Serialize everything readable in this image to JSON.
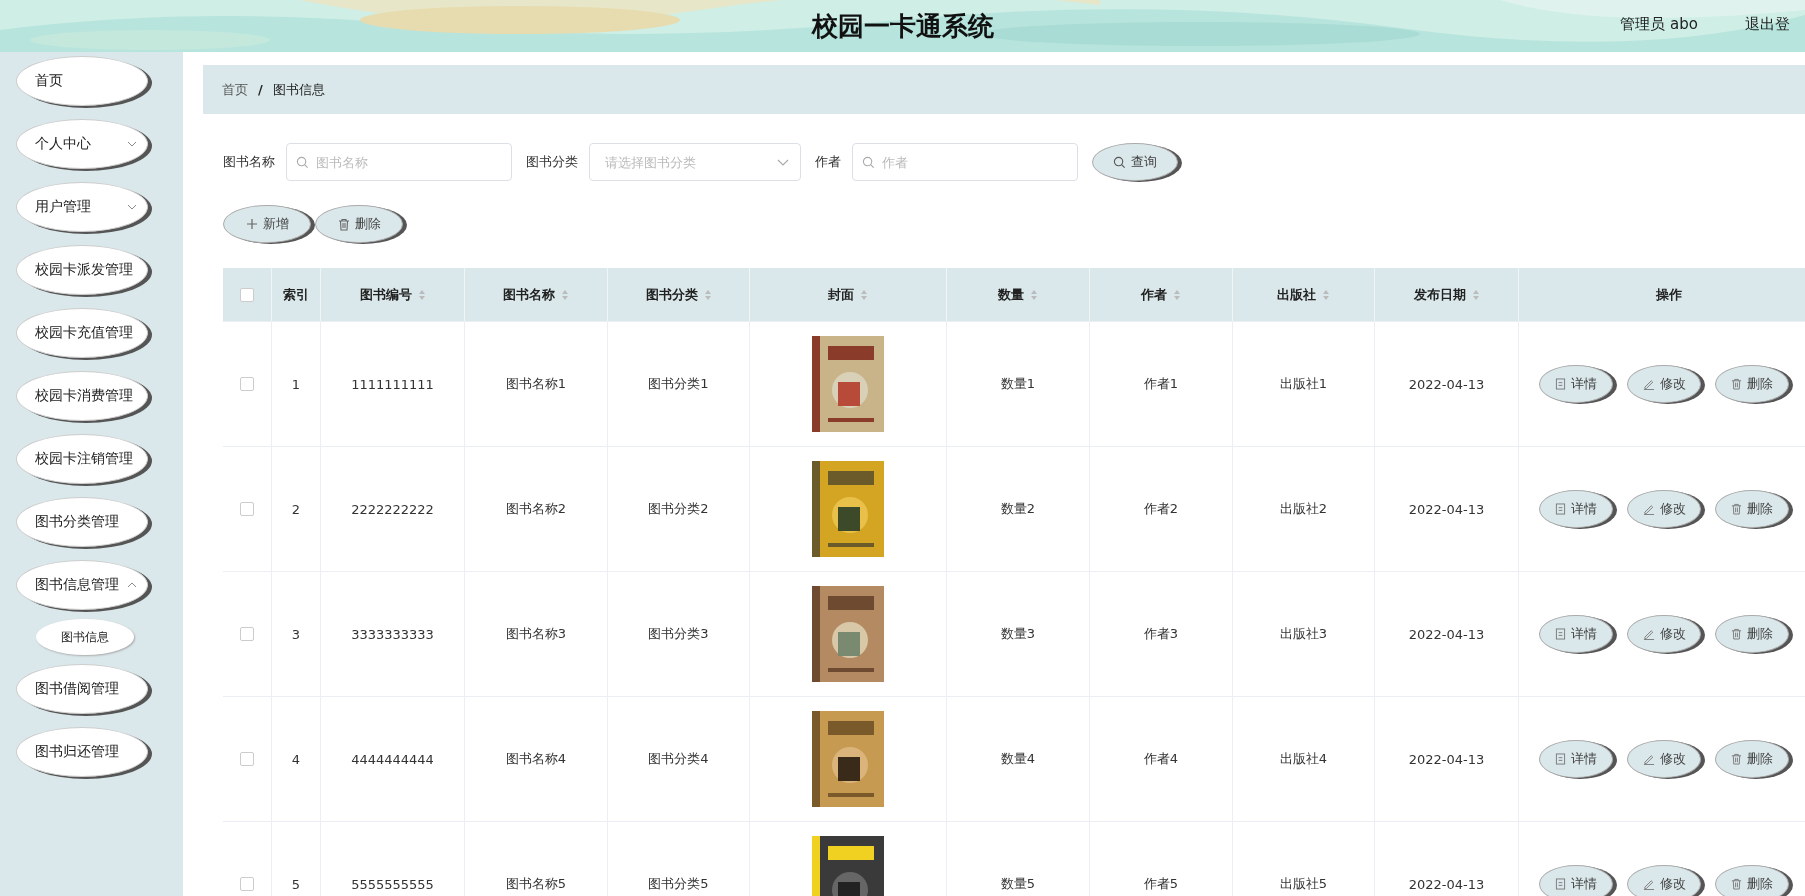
{
  "header": {
    "title": "校园一卡通系统",
    "user": "管理员 abo",
    "logout": "退出登"
  },
  "sidebar": {
    "items": [
      {
        "label": "首页"
      },
      {
        "label": "个人中心",
        "expanded": false
      },
      {
        "label": "用户管理",
        "expanded": false
      },
      {
        "label": "校园卡派发管理"
      },
      {
        "label": "校园卡充值管理"
      },
      {
        "label": "校园卡消费管理"
      },
      {
        "label": "校园卡注销管理"
      },
      {
        "label": "图书分类管理"
      },
      {
        "label": "图书信息管理",
        "expanded": true,
        "children": [
          {
            "label": "图书信息"
          }
        ]
      },
      {
        "label": "图书借阅管理"
      },
      {
        "label": "图书归还管理"
      }
    ]
  },
  "breadcrumb": [
    "首页",
    "图书信息"
  ],
  "breadcrumb_separator": "/",
  "filters": [
    {
      "label": "图书名称",
      "kind": "search",
      "placeholder": "图书名称"
    },
    {
      "label": "图书分类",
      "kind": "select",
      "placeholder": "请选择图书分类"
    },
    {
      "label": "作者",
      "kind": "search",
      "placeholder": "作者"
    }
  ],
  "query_button": "查询",
  "toolbar": [
    {
      "label": "新增",
      "kind": "add"
    },
    {
      "label": "删除",
      "kind": "delete"
    }
  ],
  "table": {
    "columns": [
      "索引",
      "图书编号",
      "图书名称",
      "图书分类",
      "封面",
      "数量",
      "作者",
      "出版社",
      "发布日期",
      "操作"
    ],
    "rows": [
      {
        "checked": false,
        "cells": [
          "1",
          "1111111111",
          "图书名称1",
          "图书分类1",
          null,
          "数量1",
          "作者1",
          "出版社1",
          "2022-04-13"
        ],
        "actions": [
          {
            "label": "详情",
            "kind": "detail"
          },
          {
            "label": "修改",
            "kind": "edit"
          },
          {
            "label": "删除",
            "kind": "delete"
          }
        ]
      },
      {
        "checked": false,
        "cells": [
          "2",
          "2222222222",
          "图书名称2",
          "图书分类2",
          null,
          "数量2",
          "作者2",
          "出版社2",
          "2022-04-13"
        ],
        "actions": [
          {
            "label": "详情",
            "kind": "detail"
          },
          {
            "label": "修改",
            "kind": "edit"
          },
          {
            "label": "删除",
            "kind": "delete"
          }
        ]
      },
      {
        "checked": false,
        "cells": [
          "3",
          "3333333333",
          "图书名称3",
          "图书分类3",
          null,
          "数量3",
          "作者3",
          "出版社3",
          "2022-04-13"
        ],
        "actions": [
          {
            "label": "详情",
            "kind": "detail"
          },
          {
            "label": "修改",
            "kind": "edit"
          },
          {
            "label": "删除",
            "kind": "delete"
          }
        ]
      },
      {
        "checked": false,
        "cells": [
          "4",
          "4444444444",
          "图书名称4",
          "图书分类4",
          null,
          "数量4",
          "作者4",
          "出版社4",
          "2022-04-13"
        ],
        "actions": [
          {
            "label": "详情",
            "kind": "detail"
          },
          {
            "label": "修改",
            "kind": "edit"
          },
          {
            "label": "删除",
            "kind": "delete"
          }
        ]
      },
      {
        "checked": false,
        "cells": [
          "5",
          "5555555555",
          "图书名称5",
          "图书分类5",
          null,
          "数量5",
          "作者5",
          "出版社5",
          "2022-04-13"
        ],
        "actions": [
          {
            "label": "详情",
            "kind": "detail"
          },
          {
            "label": "修改",
            "kind": "edit"
          },
          {
            "label": "删除",
            "kind": "delete"
          }
        ]
      }
    ],
    "select_all_checked": false
  }
}
